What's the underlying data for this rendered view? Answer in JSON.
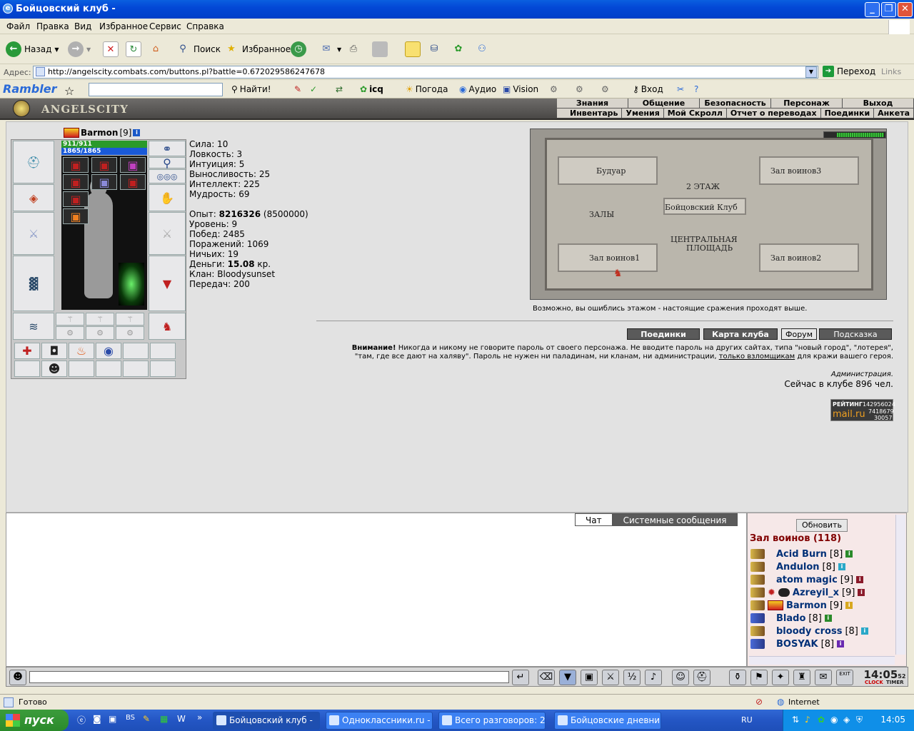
{
  "window": {
    "title": "Бойцовский клуб -"
  },
  "menu": [
    "Файл",
    "Правка",
    "Вид",
    "Избранное",
    "Сервис",
    "Справка"
  ],
  "toolbar": {
    "back": "Назад",
    "search": "Поиск",
    "favorites": "Избранное"
  },
  "address": {
    "label": "Адрес:",
    "url": "http://angelscity.combats.com/buttons.pl?battle=0.672029586247678",
    "go": "Переход",
    "links": "Links"
  },
  "rambler": {
    "logo": "Rambler",
    "find": "Найти!",
    "icq": "icq",
    "weather": "Погода",
    "audio": "Аудио",
    "vision": "Vision",
    "login": "Вход"
  },
  "game": {
    "logo": "ANGELSCITY",
    "topnav": [
      "Знания",
      "Общение",
      "Безопасность",
      "Персонаж",
      "Выход"
    ],
    "subnav": [
      "Инвентарь",
      "Умения",
      "Мой Скролл",
      "Отчет о переводах",
      "Поединки",
      "Анкета"
    ],
    "character": {
      "name": "Barmon",
      "level": "[9]",
      "hp": "911/911",
      "mana": "1865/1865"
    },
    "stats": {
      "strength": "Сила: 10",
      "agility": "Ловкость: 3",
      "intuition": "Интуиция: 5",
      "endurance": "Выносливость: 25",
      "intellect": "Интеллект: 225",
      "wisdom": "Мудрость: 69",
      "exp_label": "Опыт: ",
      "exp_value": "8216326",
      "exp_next": " (8500000)",
      "level": "Уровень: 9",
      "wins": "Побед: 2485",
      "losses": "Поражений: 1069",
      "draws": "Ничьих: 19",
      "money_label": "Деньги: ",
      "money_value": "15.08",
      "money_unit": " кр.",
      "clan": "Клан: Bloodysunset",
      "transfers": "Передач: 200"
    },
    "map": {
      "boudoir": "Будуар",
      "hall3": "Зал воинов3",
      "floor2": "2 ЭТАЖ",
      "club": "Бойцовский Клуб",
      "halls": "ЗАЛЫ",
      "central": "ЦЕНТРАЛЬНАЯ",
      "square": "ПЛОЩАДЬ",
      "hall1": "Зал воинов1",
      "hall2": "Зал воинов2"
    },
    "map_note": "Возможно, вы ошиблись этажом - настоящие сражения проходят выше.",
    "buttons": [
      "Поединки",
      "Карта клуба",
      "Форум",
      "Подсказка"
    ],
    "warning": {
      "bold": "Внимание!",
      "text1": " Никогда и никому не говорите пароль от своего персонажа. Не вводите пароль на других сайтах, типа \"новый город\", \"лотерея\", \"там, где все дают на халяву\". Пароль не нужен ни паладинам, ни кланам, ни администрации, ",
      "link": "только взломщикам",
      "text2": " для кражи вашего героя."
    },
    "admin": "Администрация.",
    "online": "Сейчас в клубе 896 чел.",
    "counter": {
      "label": "РЕЙТИНГ",
      "brand": "mail.ru",
      "n1": "142956024",
      "n2": "7418679",
      "n3": "30057"
    }
  },
  "chat": {
    "tab_chat": "Чат",
    "tab_system": "Системные сообщения"
  },
  "users": {
    "refresh": "Обновить",
    "room": "Зал воинов (118)",
    "list": [
      {
        "name": "Acid Burn",
        "level": "[8]"
      },
      {
        "name": "Andulon",
        "level": "[8]"
      },
      {
        "name": "atom magic",
        "level": "[9]"
      },
      {
        "name": "Azreyil_x",
        "level": "[9]"
      },
      {
        "name": "Barmon",
        "level": "[9]"
      },
      {
        "name": "Blado",
        "level": "[8]"
      },
      {
        "name": "bloody cross",
        "level": "[8]"
      },
      {
        "name": "BOSYAK",
        "level": "[8]"
      }
    ]
  },
  "clock": {
    "time": "14:05",
    "sec": "52",
    "label1": "CLOCK",
    "label2": "TIMER",
    "exit": "EXIT"
  },
  "status": {
    "text": "Готово",
    "zone": "Internet"
  },
  "taskbar": {
    "start": "пуск",
    "tasks": [
      "Бойцовский клуб -",
      "Одноклассники.ru - ...",
      "Всего разговоров: 2...",
      "Бойцовские дневни..."
    ],
    "lang": "RU",
    "time": "14:05"
  }
}
